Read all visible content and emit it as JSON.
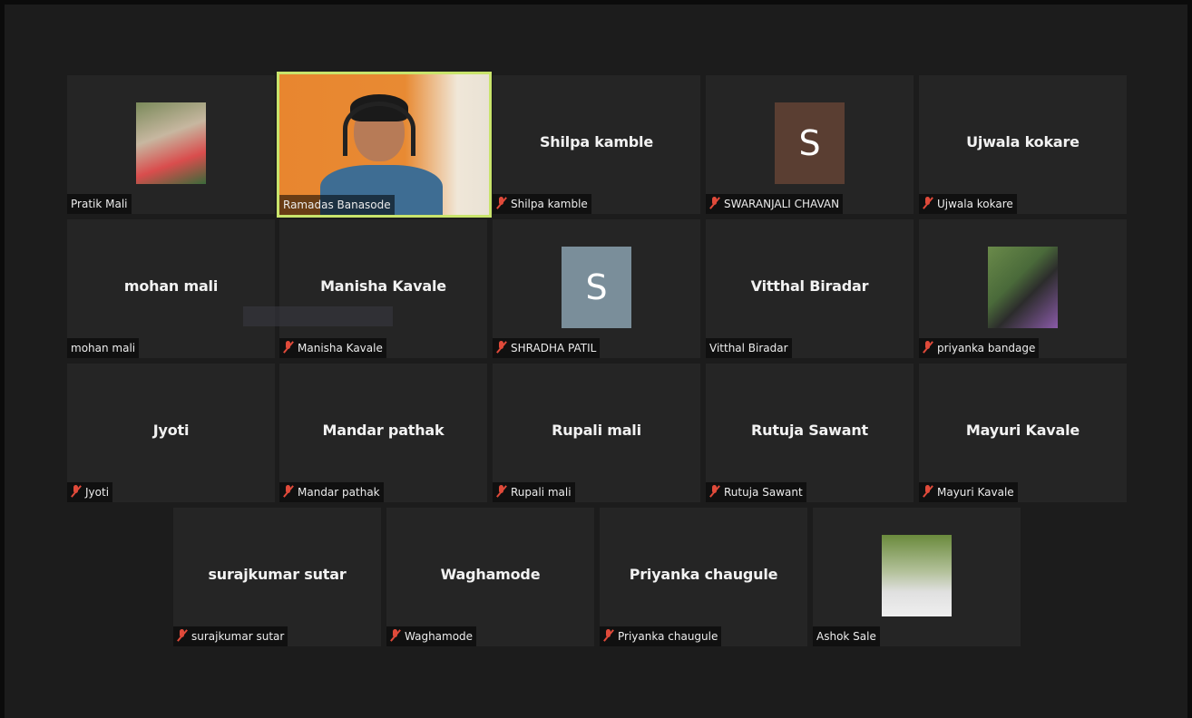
{
  "participants": [
    {
      "name": "Pratik Mali",
      "label": "Pratik Mali",
      "muted": false,
      "display": "photo"
    },
    {
      "name": "Ramadas Banasode",
      "label": "Ramadas Banasode",
      "muted": false,
      "display": "video",
      "speaking": true
    },
    {
      "name": "Shilpa kamble",
      "label": "Shilpa kamble",
      "muted": true,
      "display": "name"
    },
    {
      "name": "SWARANJALI CHAVAN",
      "label": "SWARANJALI CHAVAN",
      "muted": true,
      "display": "initial",
      "initial": "S",
      "color": "#5a3e32"
    },
    {
      "name": "Ujwala kokare",
      "label": "Ujwala kokare",
      "muted": true,
      "display": "name"
    },
    {
      "name": "mohan mali",
      "label": "mohan mali",
      "muted": false,
      "display": "name"
    },
    {
      "name": "Manisha Kavale",
      "label": "Manisha Kavale",
      "muted": true,
      "display": "name"
    },
    {
      "name": "SHRADHA PATIL",
      "label": "SHRADHA PATIL",
      "muted": true,
      "display": "initial",
      "initial": "S",
      "color": "#7a8e9a"
    },
    {
      "name": "Vitthal Biradar",
      "label": "Vitthal Biradar",
      "muted": false,
      "display": "name"
    },
    {
      "name": "priyanka bandage",
      "label": "priyanka bandage",
      "muted": true,
      "display": "photo"
    },
    {
      "name": "Jyoti",
      "label": "Jyoti",
      "muted": true,
      "display": "name"
    },
    {
      "name": "Mandar pathak",
      "label": "Mandar pathak",
      "muted": true,
      "display": "name"
    },
    {
      "name": "Rupali mali",
      "label": "Rupali mali",
      "muted": true,
      "display": "name"
    },
    {
      "name": "Rutuja Sawant",
      "label": "Rutuja Sawant",
      "muted": true,
      "display": "name"
    },
    {
      "name": "Mayuri Kavale",
      "label": "Mayuri Kavale",
      "muted": true,
      "display": "name"
    },
    {
      "name": "surajkumar sutar",
      "label": "surajkumar sutar",
      "muted": true,
      "display": "name"
    },
    {
      "name": "Waghamode",
      "label": "Waghamode",
      "muted": true,
      "display": "name"
    },
    {
      "name": "Priyanka chaugule",
      "label": "Priyanka chaugule",
      "muted": true,
      "display": "name"
    },
    {
      "name": "Ashok Sale",
      "label": "Ashok Sale",
      "muted": false,
      "display": "photo"
    }
  ],
  "colors": {
    "background": "#1c1c1c",
    "tile": "#252525",
    "active_speaker_border": "#c9e46c",
    "muted_icon": "#e04a3a"
  }
}
